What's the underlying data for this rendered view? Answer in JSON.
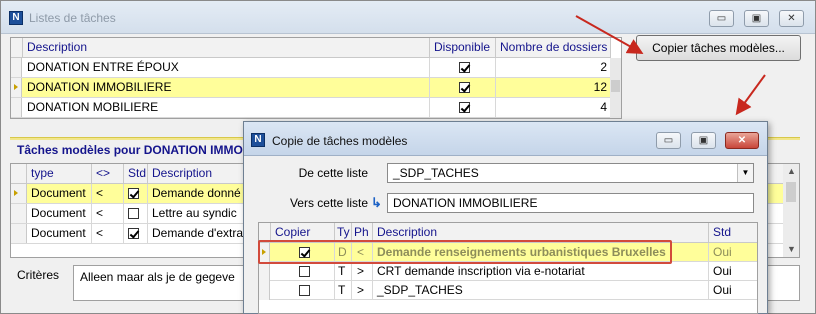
{
  "main_window": {
    "title": "Listes de tâches",
    "controls": {
      "minimize": "▭",
      "maximize": "▣",
      "close": "✕"
    }
  },
  "tasks_list": {
    "headers": {
      "description": "Description",
      "available": "Disponible",
      "count": "Nombre de dossiers"
    },
    "rows": [
      {
        "description": "DONATION ENTRE ÉPOUX",
        "available": true,
        "count": "2"
      },
      {
        "description": "DONATION IMMOBILIERE",
        "available": true,
        "count": "12"
      },
      {
        "description": "DONATION MOBILIERE",
        "available": true,
        "count": "4"
      }
    ],
    "selected_index": 1
  },
  "copy_button": {
    "label": "Copier tâches modèles..."
  },
  "model_tasks": {
    "section_title": "Tâches modèles pour DONATION IMMO",
    "headers": {
      "type": "type",
      "op": "<>",
      "std": "Std",
      "description": "Description"
    },
    "rows": [
      {
        "type": "Document",
        "op": "<",
        "std": true,
        "description": "Demande donné"
      },
      {
        "type": "Document",
        "op": "<",
        "std": false,
        "description": "Lettre au syndic"
      },
      {
        "type": "Document",
        "op": "<",
        "std": true,
        "description": "Demande d'extra"
      }
    ]
  },
  "criteria": {
    "label": "Critères",
    "value": "Alleen maar als je de gegeve"
  },
  "dialog": {
    "title": "Copie de tâches modèles",
    "from_label": "De cette liste",
    "from_value": "_SDP_TACHES",
    "to_label": "Vers cette liste",
    "to_value": "DONATION IMMOBILIERE",
    "headers": {
      "copy": "Copier",
      "type": "Ty",
      "ph": "Ph",
      "description": "Description",
      "std": "Std"
    },
    "rows": [
      {
        "copy": true,
        "type": "D",
        "ph": "<",
        "description": "Demande renseignements urbanistiques Bruxelles",
        "std": "Oui"
      },
      {
        "copy": false,
        "type": "T",
        "ph": ">",
        "description": "CRT demande inscription via e-notariat",
        "std": "Oui"
      },
      {
        "copy": false,
        "type": "T",
        "ph": ">",
        "description": "_SDP_TACHES",
        "std": "Oui"
      }
    ]
  },
  "colors": {
    "selected_row": "#fffe9a",
    "header_text": "#14148c",
    "annotation": "#c8281e"
  }
}
